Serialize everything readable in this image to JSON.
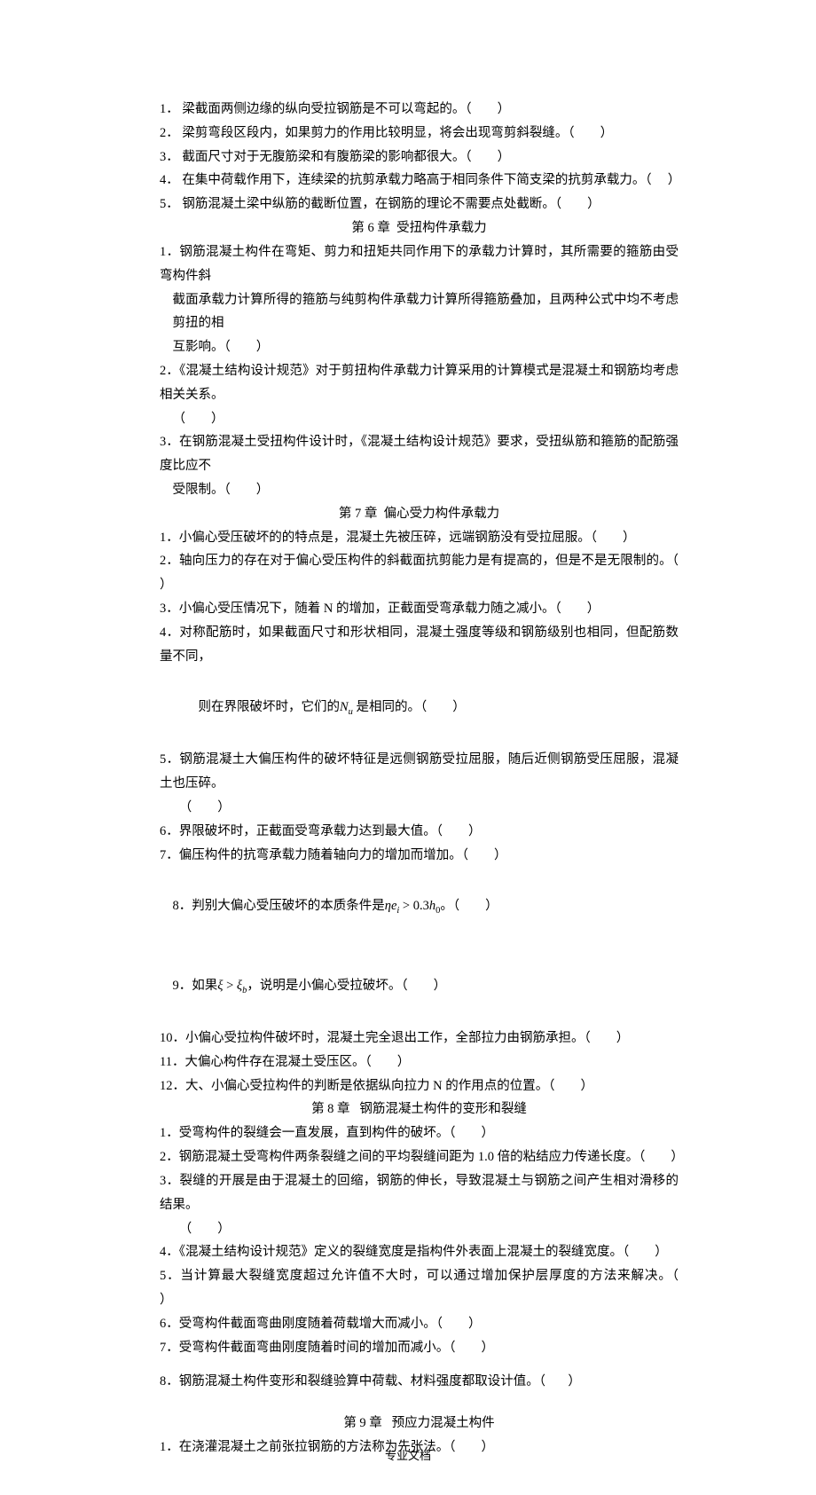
{
  "section1": [
    "1． 梁截面两侧边缘的纵向受拉钢筋是不可以弯起的。（        ）",
    "2． 梁剪弯段区段内，如果剪力的作用比较明显，将会出现弯剪斜裂缝。（        ）",
    "3． 截面尺寸对于无腹筋梁和有腹筋梁的影响都很大。（        ）",
    "4． 在集中荷载作用下，连续梁的抗剪承载力略高于相同条件下简支梁的抗剪承载力。（     ）",
    "5． 钢筋混凝土梁中纵筋的截断位置，在钢筋的理论不需要点处截断。（        ）"
  ],
  "chapter6_title": "第 6 章  受扭构件承载力",
  "q6": {
    "q1a": "1．钢筋混凝土构件在弯矩、剪力和扭矩共同作用下的承载力计算时，其所需要的箍筋由受弯构件斜",
    "q1b": "截面承载力计算所得的箍筋与纯剪构件承载力计算所得箍筋叠加，且两种公式中均不考虑剪扭的相",
    "q1c": "互影响。（        ）",
    "q2a": "2．《混凝土结构设计规范》对于剪扭构件承载力计算采用的计算模式是混凝土和钢筋均考虑相关关系。",
    "q2b": "（        ）",
    "q3a": "3．在钢筋混凝土受扭构件设计时，《混凝土结构设计规范》要求，受扭纵筋和箍筋的配筋强度比应不",
    "q3b": "受限制。（        ）"
  },
  "chapter7_title": "第 7 章  偏心受力构件承载力",
  "q7": {
    "q1": "1．小偏心受压破坏的的特点是，混凝土先被压碎，远端钢筋没有受拉屈服。（        ）",
    "q2": "2．轴向压力的存在对于偏心受压构件的斜截面抗剪能力是有提高的，但是不是无限制的。（        ）",
    "q3": "3．小偏心受压情况下，随着 N 的增加，正截面受弯承载力随之减小。（        ）",
    "q4a": "4．对称配筋时，如果截面尺寸和形状相同，混凝土强度等级和钢筋级别也相同，但配筋数量不同，",
    "q4b_pre": "则在界限破坏时，它们的",
    "q4b_post": " 是相同的。（        ）",
    "q5a": "5．钢筋混凝土大偏压构件的破坏特征是远侧钢筋受拉屈服，随后近侧钢筋受压屈服，混凝土也压碎。",
    "q5b": "（        ）",
    "q6a": "6．界限破坏时，正截面受弯承载力达到最大值。（        ）",
    "q7a": "7．偏压构件的抗弯承载力随着轴向力的增加而增加。（        ）",
    "q8_pre": "8．判别大偏心受压破坏的本质条件是",
    "q8_post": "。（        ）",
    "q9_pre": "9．如果",
    "q9_post": "，说明是小偏心受拉破坏。（        ）",
    "q10": "10．小偏心受拉构件破坏时，混凝土完全退出工作，全部拉力由钢筋承担。（        ）",
    "q11": "11．大偏心构件存在混凝土受压区。（        ）",
    "q12": "12．大、小偏心受拉构件的判断是依据纵向拉力 N 的作用点的位置。（        ）"
  },
  "chapter8_title": "第 8 章   钢筋混凝土构件的变形和裂缝",
  "q8": {
    "q1": "1．受弯构件的裂缝会一直发展，直到构件的破坏。（        ）",
    "q2": "2．钢筋混凝土受弯构件两条裂缝之间的平均裂缝间距为 1.0 倍的粘结应力传递长度。（        ）",
    "q3a": "3．裂缝的开展是由于混凝土的回缩，钢筋的伸长，导致混凝土与钢筋之间产生相对滑移的结果。",
    "q3b": "（        ）",
    "q4": "4．《混凝土结构设计规范》定义的裂缝宽度是指构件外表面上混凝土的裂缝宽度。（        ）",
    "q5": "5．当计算最大裂缝宽度超过允许值不大时，可以通过增加保护层厚度的方法来解决。（        ）",
    "q6a": "6．受弯构件截面弯曲刚度随着荷载增大而减小。（        ）",
    "q7a": "7．受弯构件截面弯曲刚度随着时间的增加而减小。（        ）",
    "q8a": "8．钢筋混凝土构件变形和裂缝验算中荷载、材料强度都取设计值。（       ）"
  },
  "chapter9_title": "第 9 章   预应力混凝土构件",
  "q9": {
    "q1": "1．在浇灌混凝土之前张拉钢筋的方法称为先张法。（        ）"
  },
  "formula": {
    "Nu_var": "N",
    "Nu_sub": "u",
    "eta": "η",
    "e": "e",
    "i": "i",
    "gt": ">",
    "coef": "0.3",
    "h": "h",
    "zero": "0",
    "xi": "ξ",
    "b": "b"
  },
  "footer": "专业文档"
}
